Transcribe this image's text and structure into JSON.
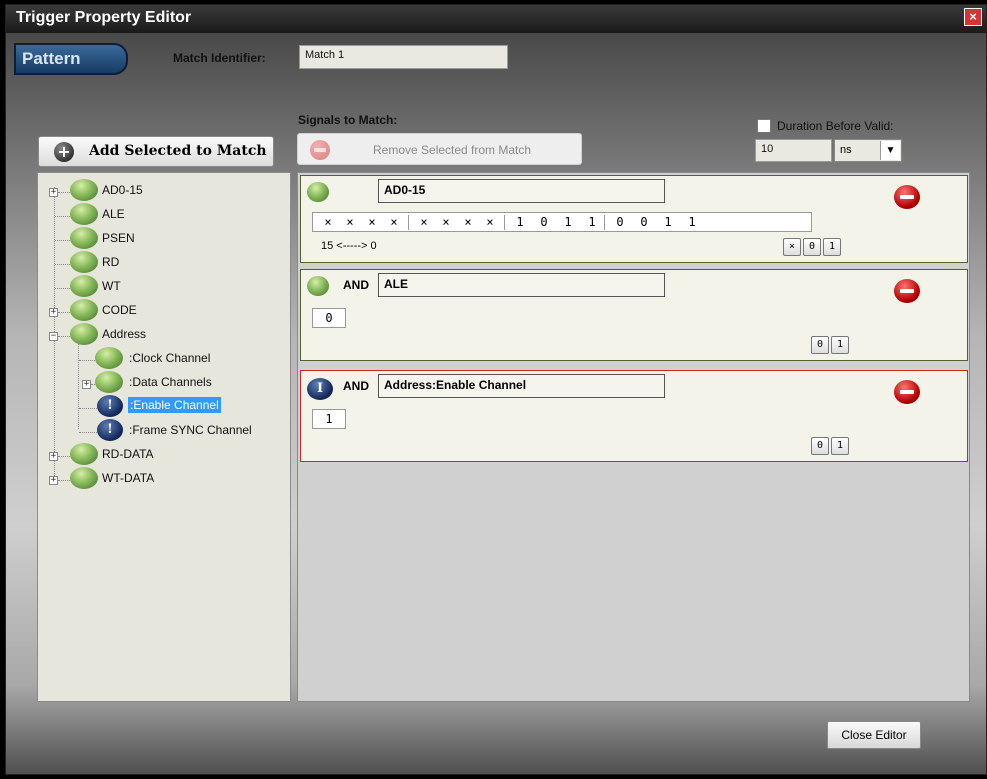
{
  "window": {
    "title": "Trigger Property Editor",
    "close_symbol": "×"
  },
  "tab": {
    "label": "Pattern"
  },
  "match_identifier": {
    "label": "Match Identifier:",
    "value": "Match 1"
  },
  "signals": {
    "label": "Signals to Match:"
  },
  "buttons": {
    "add_selected": "Add Selected to Match",
    "add_symbol": "+",
    "remove_selected": "Remove Selected from Match",
    "close_editor": "Close Editor"
  },
  "duration": {
    "label": "Duration Before Valid:",
    "value": "10",
    "unit": "ns",
    "checked": false
  },
  "tree": {
    "items": [
      {
        "label": "AD0-15"
      },
      {
        "label": "ALE"
      },
      {
        "label": "PSEN"
      },
      {
        "label": "RD"
      },
      {
        "label": "WT"
      },
      {
        "label": "CODE"
      },
      {
        "label": "Address"
      },
      {
        "label": ":Clock Channel"
      },
      {
        "label": ":Data Channels"
      },
      {
        "label": ":Enable Channel"
      },
      {
        "label": ":Frame SYNC Channel"
      },
      {
        "label": "RD-DATA"
      },
      {
        "label": "WT-DATA"
      }
    ],
    "expand_plus": "+",
    "expand_minus": "−",
    "selected": ":Enable Channel",
    "info_symbol": "!"
  },
  "matches": [
    {
      "name": "AD0-15",
      "bits": [
        "×",
        "×",
        "×",
        "×",
        "×",
        "×",
        "×",
        "×",
        "1",
        "0",
        "1",
        "1",
        "0",
        "0",
        "1",
        "1"
      ],
      "range": "15 <-----> 0",
      "buttons": [
        "×",
        "0",
        "1"
      ]
    },
    {
      "and": "AND",
      "name": "ALE",
      "value": "0",
      "buttons": [
        "0",
        "1"
      ]
    },
    {
      "and": "AND",
      "name": "Address:Enable Channel",
      "value": "1",
      "buttons": [
        "0",
        "1"
      ],
      "info_symbol": "I"
    }
  ],
  "colors": {
    "tab": "#1f4a78",
    "selection": "#3399ff",
    "error_border": "#d22424",
    "panel_border": "#4f6233"
  }
}
